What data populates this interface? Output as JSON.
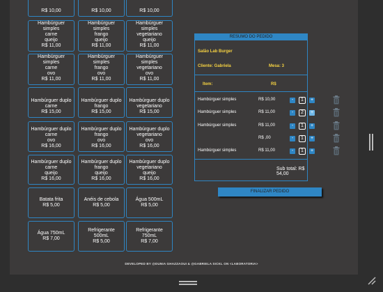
{
  "menu": {
    "items": [
      {
        "name": "",
        "price": "R$ 10,00"
      },
      {
        "name": "",
        "price": "R$ 10,00"
      },
      {
        "name": "",
        "price": "R$ 10,00"
      },
      {
        "name": "Hambúrguer\nsimples\ncarne\nqueijo",
        "price": "R$ 11,00"
      },
      {
        "name": "Hambúrguer\nsimples\nfrango\nqueijo",
        "price": "R$ 11,00"
      },
      {
        "name": "Hambúrguer\nsimples\nvegetariano\nqueijo",
        "price": "R$ 11,00"
      },
      {
        "name": "Hambúrguer\nsimples\ncarne\novo",
        "price": "R$ 11,00"
      },
      {
        "name": "Hambúrguer\nsimples\nfrango\novo",
        "price": "R$ 11,00"
      },
      {
        "name": "Hambúrguer\nsimples\nvegetariano\novo",
        "price": "R$ 11,00"
      },
      {
        "name": "Hambúrguer duplo\ncarne",
        "price": "R$ 15,00"
      },
      {
        "name": "Hambúrguer duplo\nfrango",
        "price": "R$ 15,00"
      },
      {
        "name": "Hambúrguer duplo\nvegetariano",
        "price": "R$ 15,00"
      },
      {
        "name": "Hambúrguer duplo\ncarne\novo",
        "price": "R$ 16,00"
      },
      {
        "name": "Hambúrguer duplo\nfrango\novo",
        "price": "R$ 16,00"
      },
      {
        "name": "Hambúrguer duplo\nvegetariano\novo",
        "price": "R$ 16,00"
      },
      {
        "name": "Hambúrguer duplo\ncarne\nqueijo",
        "price": "R$ 16,00"
      },
      {
        "name": "Hambúrguer duplo\nfrango\nqueijo",
        "price": "R$ 16,00"
      },
      {
        "name": "Hambúrguer duplo\nvegetariano\nqueijo",
        "price": "R$ 16,00"
      },
      {
        "name": "Batata frita",
        "price": "R$ 5,00"
      },
      {
        "name": "Anéis de cebola",
        "price": "R$ 5,00"
      },
      {
        "name": "Água 500mL",
        "price": "R$ 5,00"
      },
      {
        "name": "Água 750mL",
        "price": "R$ 7,00"
      },
      {
        "name": "Refrigerante\n500mL",
        "price": "R$ 5,00"
      },
      {
        "name": "Refrigerante\n750mL",
        "price": "R$ 7,00"
      }
    ]
  },
  "order": {
    "title": "RESUMO DO PEDIDO",
    "restaurant": "Salão Lab Burger",
    "client_label": "Cliente: Gabriela",
    "table_label": "Mesa: 3",
    "item_label": "Item:",
    "currency_label": "R$",
    "items": [
      {
        "name": "Hambúrguer simples",
        "price": "R$ 10,00",
        "qty": "1"
      },
      {
        "name": "Hambúrguer simples",
        "price": "R$ 11,00",
        "qty": "2"
      },
      {
        "name": "Hambúrguer simples",
        "price": "R$ 11,00",
        "qty": "1"
      },
      {
        "name": "",
        "price": "R$ ,00",
        "qty": "1"
      },
      {
        "name": "Hambúrguer simples",
        "price": "R$ 11,00",
        "qty": "1"
      }
    ],
    "minus_label": "-",
    "plus_label": "+",
    "subtotal": "Sub total: R$ 54,00"
  },
  "finalize_label": "FINALIZAR PEDIDO",
  "footer": "DEVELOPED BY  @DUNIA GHAZZAOUI  &  @GABRIELA SICKL  ON  <LABORATORIA>",
  "colors": {
    "accent": "#2f86c4",
    "highlight": "#f5d142",
    "panel_bg": "#3c3a3a"
  },
  "icons": [
    "trash-icon",
    "resize-icon",
    "scroll-handle",
    "drag-grip"
  ]
}
